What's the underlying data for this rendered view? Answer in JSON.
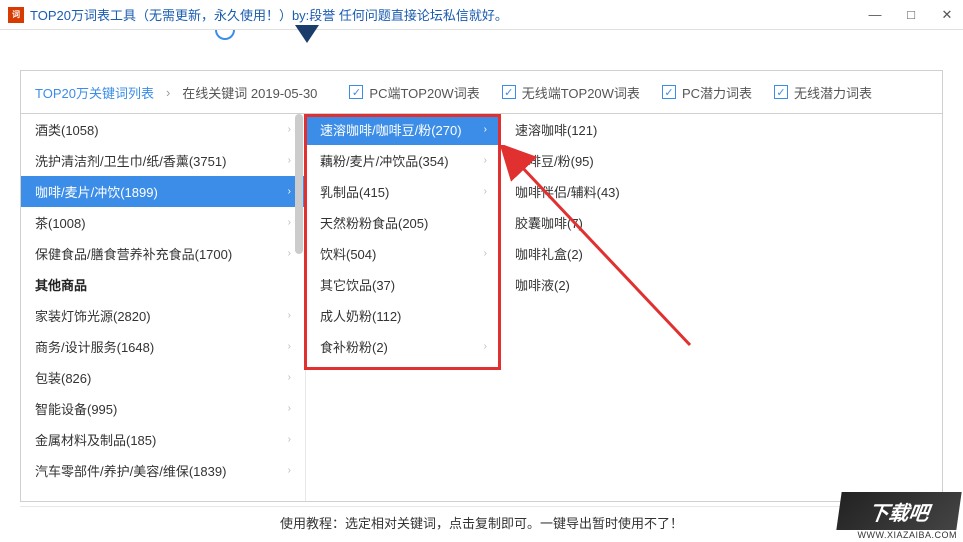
{
  "window": {
    "title": "TOP20万词表工具（无需更新，永久使用！）by:段誉  任何问题直接论坛私信就好。",
    "minimize": "—",
    "maximize": "□",
    "close": "✕"
  },
  "breadcrumb": {
    "root": "TOP20万关键词列表",
    "current": "在线关键词 2019-05-30"
  },
  "filters": {
    "pc_top20w": "PC端TOP20W词表",
    "wireless_top20w": "无线端TOP20W词表",
    "pc_potential": "PC潜力词表",
    "wireless_potential": "无线潜力词表"
  },
  "col1": {
    "items": [
      {
        "label": "酒类(1058)",
        "chev": true
      },
      {
        "label": "洗护清洁剂/卫生巾/纸/香薰(3751)",
        "chev": true
      },
      {
        "label": "咖啡/麦片/冲饮(1899)",
        "chev": true,
        "selected": true
      },
      {
        "label": "茶(1008)",
        "chev": true
      },
      {
        "label": "保健食品/膳食营养补充食品(1700)",
        "chev": true
      },
      {
        "label": "其他商品",
        "header": true
      },
      {
        "label": "家装灯饰光源(2820)",
        "chev": true
      },
      {
        "label": "商务/设计服务(1648)",
        "chev": true
      },
      {
        "label": "包装(826)",
        "chev": true
      },
      {
        "label": "智能设备(995)",
        "chev": true
      },
      {
        "label": "金属材料及制品(185)",
        "chev": true
      },
      {
        "label": "汽车零部件/养护/美容/维保(1839)",
        "chev": true
      }
    ]
  },
  "col2": {
    "items": [
      {
        "label": "速溶咖啡/咖啡豆/粉(270)",
        "chev": true,
        "selected": true
      },
      {
        "label": "藕粉/麦片/冲饮品(354)",
        "chev": true
      },
      {
        "label": "乳制品(415)",
        "chev": true
      },
      {
        "label": "天然粉粉食品(205)"
      },
      {
        "label": "饮料(504)",
        "chev": true
      },
      {
        "label": "其它饮品(37)"
      },
      {
        "label": "成人奶粉(112)"
      },
      {
        "label": "食补粉粉(2)",
        "chev": true
      }
    ]
  },
  "col3": {
    "items": [
      {
        "label": "速溶咖啡(121)"
      },
      {
        "label": "咖啡豆/粉(95)"
      },
      {
        "label": "咖啡伴侣/辅料(43)"
      },
      {
        "label": "胶囊咖啡(7)"
      },
      {
        "label": "咖啡礼盒(2)"
      },
      {
        "label": "咖啡液(2)"
      }
    ]
  },
  "footer": "使用教程：选定相对关键词，点击复制即可。一键导出暂时使用不了！",
  "watermark": {
    "logo": "下载吧",
    "url": "WWW.XIAZAIBA.COM"
  }
}
